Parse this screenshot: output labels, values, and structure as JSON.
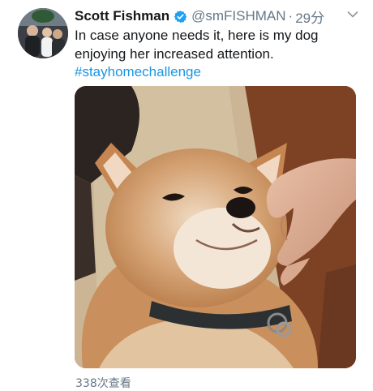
{
  "tweet": {
    "author_name": "Scott Fishman",
    "handle": "@smFISHMAN",
    "separator": "·",
    "time": "29分",
    "text_lines": [
      "In case anyone needs it, here is my dog",
      "enjoying her increased attention."
    ],
    "hashtag": "#stayhomechallenge",
    "views": "338次查看"
  },
  "icons": {
    "verified": "verified-badge-icon",
    "more": "chevron-down-icon"
  },
  "colors": {
    "text": "#14171a",
    "muted": "#657786",
    "link": "#1b95e0",
    "verified": "#1da1f2"
  }
}
